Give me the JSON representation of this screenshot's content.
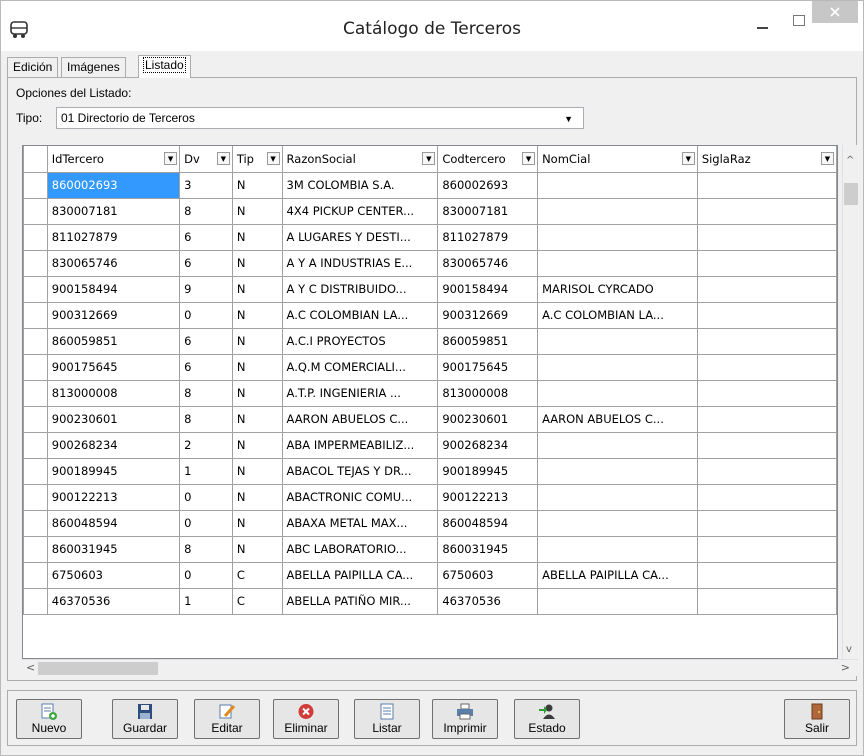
{
  "window": {
    "title": "Catálogo de Terceros"
  },
  "tabs": [
    {
      "label": "Edición"
    },
    {
      "label": "Imágenes"
    },
    {
      "label": "Listado"
    }
  ],
  "options": {
    "section_label": "Opciones del Listado:",
    "tipo_label": "Tipo:",
    "tipo_value": "01 Directorio de Terceros"
  },
  "grid": {
    "columns": [
      "IdTercero",
      "Dv",
      "Tip",
      "RazonSocial",
      "Codtercero",
      "NomCial",
      "SiglaRaz"
    ],
    "rows": [
      [
        "860002693",
        "3",
        "N",
        "3M  COLOMBIA S.A.",
        "860002693",
        "",
        ""
      ],
      [
        "830007181",
        "8",
        "N",
        "4X4 PICKUP CENTER...",
        "830007181",
        "",
        ""
      ],
      [
        "811027879",
        "6",
        "N",
        "A LUGARES Y DESTI...",
        "811027879",
        "",
        ""
      ],
      [
        "830065746",
        "6",
        "N",
        "A Y A INDUSTRIAS E...",
        "830065746",
        "",
        ""
      ],
      [
        "900158494",
        "9",
        "N",
        "A Y C DISTRIBUIDO...",
        "900158494",
        "MARISOL CYRCADO",
        ""
      ],
      [
        "900312669",
        "0",
        "N",
        "A.C COLOMBIAN LA...",
        "900312669",
        "A.C COLOMBIAN LA...",
        ""
      ],
      [
        "860059851",
        "6",
        "N",
        "A.C.I PROYECTOS",
        "860059851",
        "",
        ""
      ],
      [
        "900175645",
        "6",
        "N",
        "A.Q.M COMERCIALI...",
        "900175645",
        "",
        ""
      ],
      [
        "813000008",
        "8",
        "N",
        "A.T.P. INGENIERIA ...",
        "813000008",
        "",
        ""
      ],
      [
        "900230601",
        "8",
        "N",
        "AARON ABUELOS C...",
        "900230601",
        "AARON ABUELOS C...",
        ""
      ],
      [
        "900268234",
        "2",
        "N",
        "ABA IMPERMEABILIZ...",
        "900268234",
        "",
        ""
      ],
      [
        "900189945",
        "1",
        "N",
        "ABACOL TEJAS Y DR...",
        "900189945",
        "",
        ""
      ],
      [
        "900122213",
        "0",
        "N",
        "ABACTRONIC COMU...",
        "900122213",
        "",
        ""
      ],
      [
        "860048594",
        "0",
        "N",
        "ABAXA METAL  MAX...",
        "860048594",
        "",
        ""
      ],
      [
        "860031945",
        "8",
        "N",
        "ABC LABORATORIO...",
        "860031945",
        "",
        ""
      ],
      [
        "6750603",
        "0",
        "C",
        "ABELLA PAIPILLA CA...",
        "6750603",
        "ABELLA PAIPILLA CA...",
        ""
      ],
      [
        "46370536",
        "1",
        "C",
        "ABELLA PATIÑO MIR...",
        "46370536",
        "",
        ""
      ]
    ]
  },
  "toolbar": {
    "nuevo": "Nuevo",
    "guardar": "Guardar",
    "editar": "Editar",
    "eliminar": "Eliminar",
    "listar": "Listar",
    "imprimir": "Imprimir",
    "estado": "Estado",
    "salir": "Salir"
  },
  "colors": {
    "selection": "#3399ff",
    "close_button": "#c7c7c7"
  }
}
